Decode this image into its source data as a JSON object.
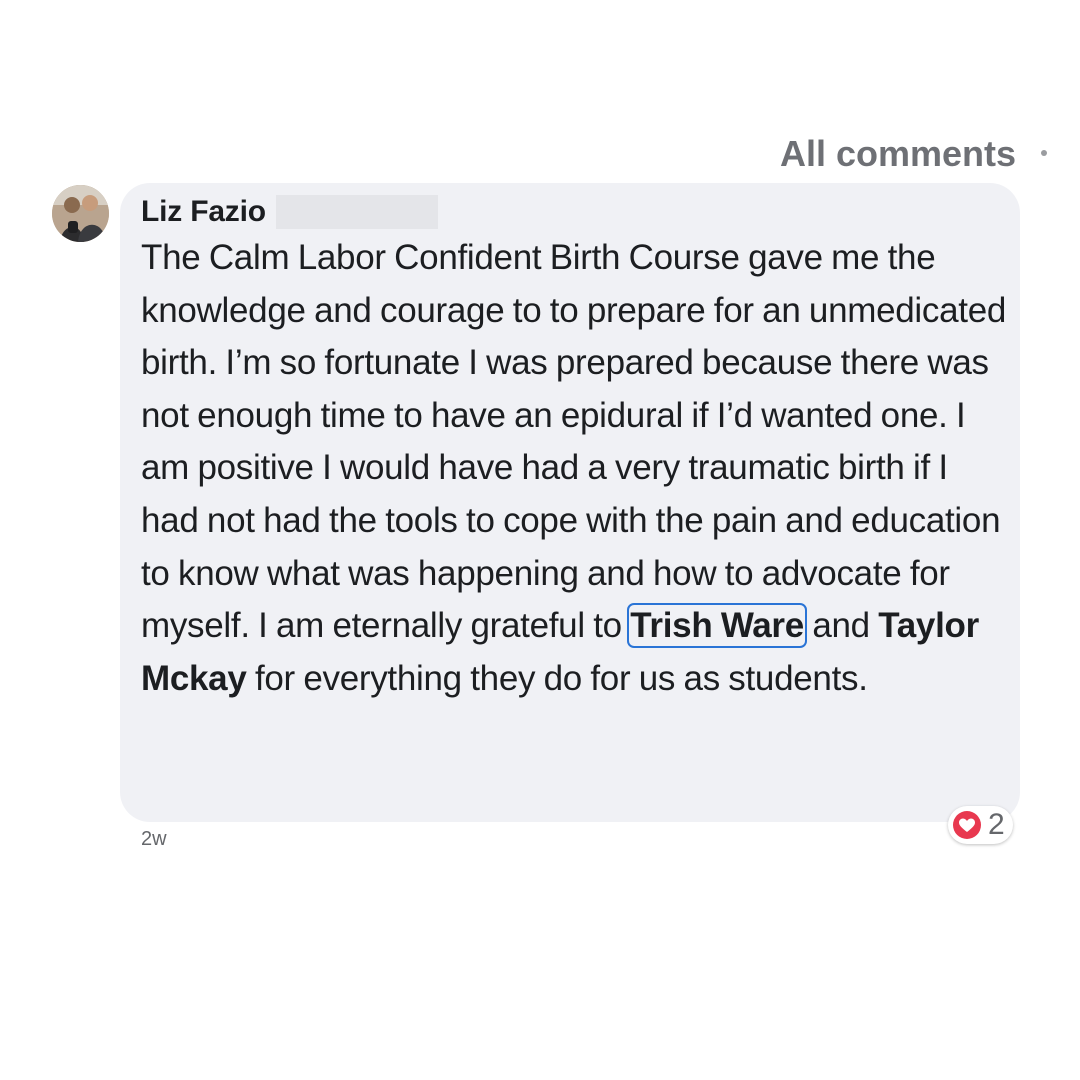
{
  "header": {
    "sort_label": "All comments"
  },
  "comment": {
    "author": "Liz Fazio",
    "avatar_icon": "profile-photo",
    "text_segments": [
      "The Calm Labor Confident Birth Course gave me the knowledge and courage to to prepare for an unmedicated birth. I’m so fortunate I was prepared because there was not enough time to have an epidural if I’d wanted one. I am positive I would have had a very traumatic birth if I had not had the tools to cope with the pain and education to know what was happening and how to advocate for myself. I am eternally grateful to ",
      " and ",
      " for everything they do for us as students."
    ],
    "mentions": [
      "Trish Ware",
      "Taylor Mckay"
    ],
    "timestamp": "2w",
    "reaction": {
      "icon": "heart-icon",
      "count": "2",
      "color": "#e8384f"
    }
  },
  "colors": {
    "bubble": "#f0f1f5",
    "text": "#1c1e21",
    "secondary_text": "#65676b",
    "mention_outline": "#2a74d6"
  }
}
